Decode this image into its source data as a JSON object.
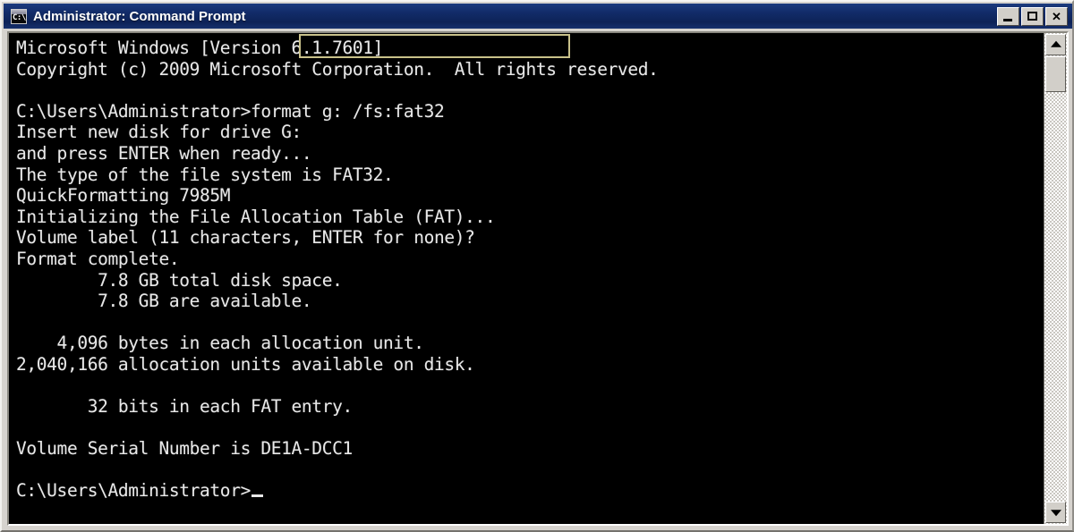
{
  "window": {
    "title": "Administrator: Command Prompt",
    "icon": "cmd-console-icon",
    "icon_text": "C:\\.",
    "titlebar_color": "#122c69",
    "controls": {
      "minimize_label": "_",
      "maximize_label": "□",
      "close_label": "✕"
    }
  },
  "console": {
    "background_color": "#000000",
    "text_color": "#e8e8e8",
    "highlight_color": "#c9c18a",
    "lines": [
      "Microsoft Windows [Version 6.1.7601]",
      "Copyright (c) 2009 Microsoft Corporation.  All rights reserved.",
      "",
      "C:\\Users\\Administrator>format g: /fs:fat32",
      "Insert new disk for drive G:",
      "and press ENTER when ready...",
      "The type of the file system is FAT32.",
      "QuickFormatting 7985M",
      "Initializing the File Allocation Table (FAT)...",
      "Volume label (11 characters, ENTER for none)?",
      "Format complete.",
      "        7.8 GB total disk space.",
      "        7.8 GB are available.",
      "",
      "    4,096 bytes in each allocation unit.",
      "2,040,166 allocation units available on disk.",
      "",
      "       32 bits in each FAT entry.",
      "",
      "Volume Serial Number is DE1A-DCC1",
      "",
      "C:\\Users\\Administrator>"
    ],
    "prompt": "C:\\Users\\Administrator>",
    "command": "format g: /fs:fat32",
    "highlighted_command": "format g: /fs:fat32",
    "cursor": "_"
  },
  "scrollbar": {
    "up_arrow": "scroll-up-arrow",
    "down_arrow": "scroll-down-arrow",
    "thumb": "scroll-thumb"
  }
}
